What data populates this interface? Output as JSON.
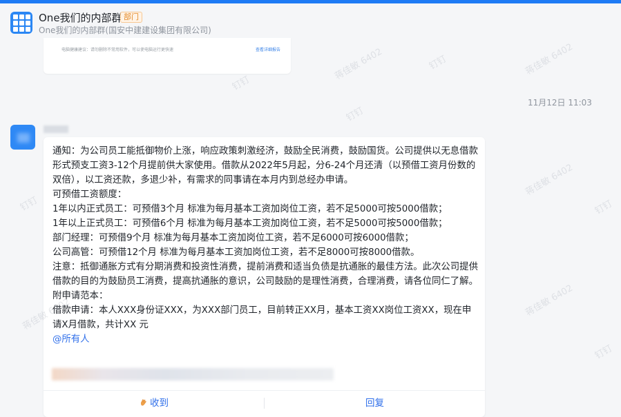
{
  "header": {
    "title": "One我们的内部群",
    "badge": "部门",
    "subtitle": "One我们的内部群(国安中建建设集团有限公司)"
  },
  "previous_message": {
    "card_text": "电脑健康建议：请勿删除不常用软件，可以使电脑运行更快速",
    "card_link": "查看详细报告"
  },
  "timestamp": "11月12日 11:03",
  "message": {
    "paragraphs": [
      "通知：为公司员工能抵御物价上涨，响应政策刺激经济，鼓励全民消费，鼓励国货。公司提供以无息借款形式预支工资3-12个月提前供大家使用。借款从2022年5月起，分6-24个月还清（以预借工资月份数的双倍），以工资还款，多退少补，有需求的同事请在本月内到总经办申请。",
      "可预借工资额度：",
      "1年以内正式员工：可预借3个月  标准为每月基本工资加岗位工资，若不足5000可按5000借款；",
      "1年以上正式员工：可预借6个月  标准为每月基本工资加岗位工资，若不足5000可按5000借款；",
      "部门经理：可预借9个月  标准为每月基本工资加岗位工资，若不足6000可按6000借款；",
      "公司高管：可预借12个月  标准为每月基本工资加岗位工资，若不足8000可按8000借款。",
      "注意：抵御通胀方式有分期消费和投资性消费，提前消费和适当负债是抗通胀的最佳方法。此次公司提供借款的目的为鼓励员工消费，提高抗通胀的意识，公司鼓励的是理性消费，合理消费，请各位同仁了解。",
      "附申请范本：",
      "借款申请：本人XXX身份证XXX，为XXX部门员工，目前转正XX月，基本工资XX岗位工资XX，现在申请X月借款，共计XX 元"
    ],
    "mention": "@所有人"
  },
  "actions": {
    "received_label": "收到",
    "reply_label": "回复"
  },
  "watermark": {
    "text_name": "蒋佳敏 6402",
    "text_brand": "钉钉"
  },
  "colors": {
    "accent": "#1e7bf5",
    "link": "#2f6fea",
    "badge": "#e38a28"
  }
}
